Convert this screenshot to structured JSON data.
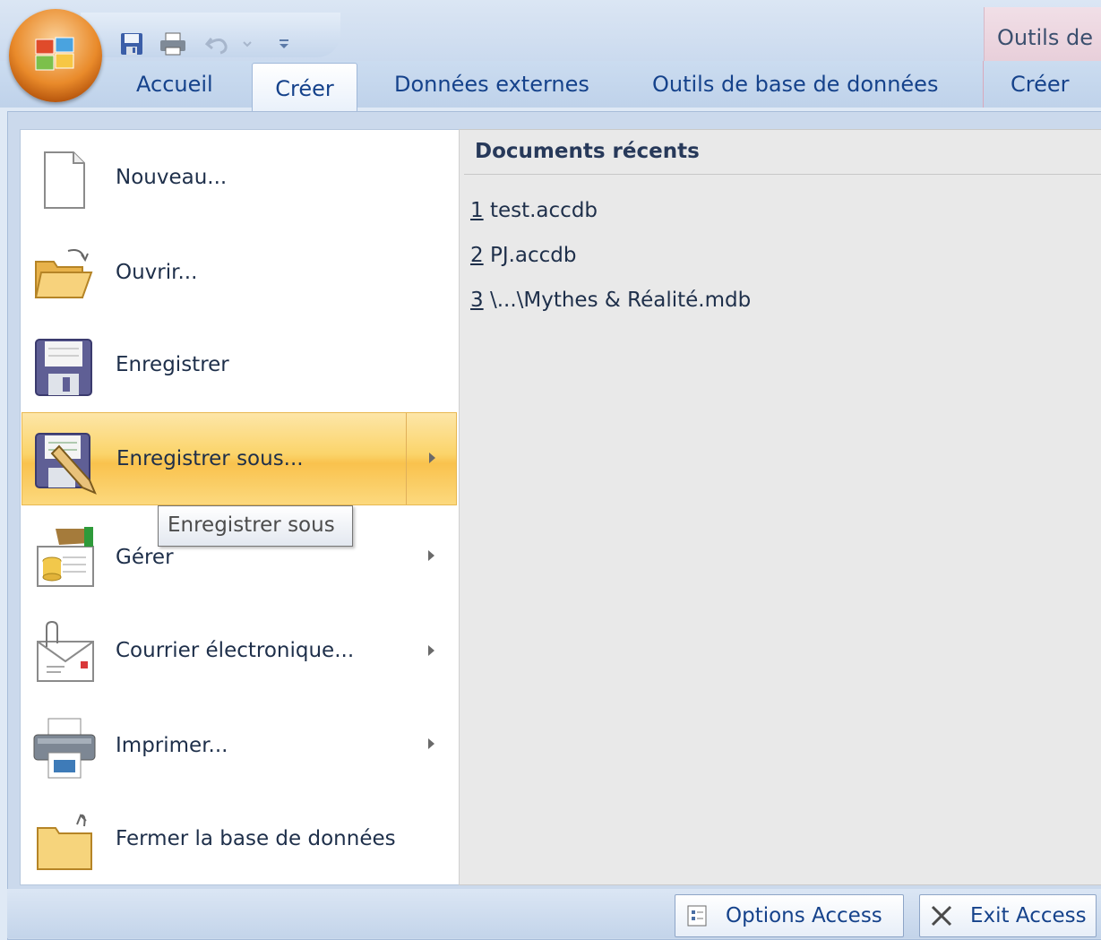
{
  "ribbon": {
    "tabs": [
      "Accueil",
      "Créer",
      "Données externes",
      "Outils de base de données",
      "Créer"
    ],
    "active_tab": "Créer",
    "context_title": "Outils de"
  },
  "menu": {
    "items": [
      {
        "label": "Nouveau...",
        "icon": "new-document-icon"
      },
      {
        "label": "Ouvrir...",
        "icon": "open-folder-icon"
      },
      {
        "label": "Enregistrer",
        "icon": "save-disk-icon"
      },
      {
        "label": "Enregistrer sous...",
        "icon": "save-as-icon"
      },
      {
        "label": "Gérer",
        "icon": "manage-database-icon"
      },
      {
        "label": "Courrier électronique...",
        "icon": "email-icon"
      },
      {
        "label": "Imprimer...",
        "icon": "printer-icon"
      },
      {
        "label": "Fermer la base de données",
        "icon": "close-database-icon"
      }
    ],
    "hover_item": "Enregistrer sous...",
    "tooltip": "Enregistrer sous"
  },
  "recent": {
    "title": "Documents récents",
    "items": [
      {
        "num": "1",
        "name": "test.accdb"
      },
      {
        "num": "2",
        "name": "PJ.accdb"
      },
      {
        "num": "3",
        "name": "\\...\\Mythes & Réalité.mdb"
      }
    ]
  },
  "footer": {
    "options_label": "Options Access",
    "exit_label": "Exit Access"
  },
  "colors": {
    "ribbon_text": "#15428b",
    "hover_gold": "#fbd46a",
    "orb_orange": "#e98a2a"
  }
}
